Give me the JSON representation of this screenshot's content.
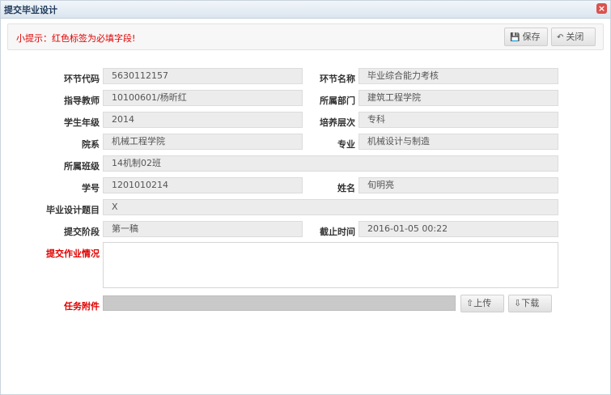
{
  "window": {
    "title": "提交毕业设计",
    "close_glyph": "×"
  },
  "toolbar": {
    "tip": "小提示：红色标签为必填字段!",
    "save_label": "保存",
    "close_label": "关闭",
    "save_icon": "disk-icon",
    "close_icon": "undo-arrow-icon"
  },
  "form": {
    "link_code": {
      "label": "环节代码",
      "value": "5630112157"
    },
    "link_name": {
      "label": "环节名称",
      "value": "毕业综合能力考核"
    },
    "advisor": {
      "label": "指导教师",
      "value": "10100601/杨昕红"
    },
    "department": {
      "label": "所属部门",
      "value": "建筑工程学院"
    },
    "grade": {
      "label": "学生年级",
      "value": "2014"
    },
    "level": {
      "label": "培养层次",
      "value": "专科"
    },
    "faculty": {
      "label": "院系",
      "value": "机械工程学院"
    },
    "major": {
      "label": "专业",
      "value": "机械设计与制造"
    },
    "class": {
      "label": "所属班级",
      "value": "14机制02班"
    },
    "student_id": {
      "label": "学号",
      "value": "1201010214"
    },
    "name": {
      "label": "姓名",
      "value": "旬明亮"
    },
    "topic": {
      "label": "毕业设计题目",
      "value": "X"
    },
    "stage": {
      "label": "提交阶段",
      "value": "第一稿"
    },
    "deadline": {
      "label": "截止时间",
      "value": "2016-01-05 00:22"
    },
    "submission": {
      "label": "提交作业情况",
      "value": ""
    },
    "attachment": {
      "label": "任务附件",
      "value": ""
    }
  },
  "attachment_buttons": {
    "upload_label": "上传",
    "download_label": "下载",
    "upload_icon": "upload-icon",
    "download_icon": "download-icon"
  },
  "colors": {
    "required": "#e00000",
    "field_bg": "#ececec",
    "file_bg": "#c9c9c9",
    "title": "#1f3a5a"
  }
}
